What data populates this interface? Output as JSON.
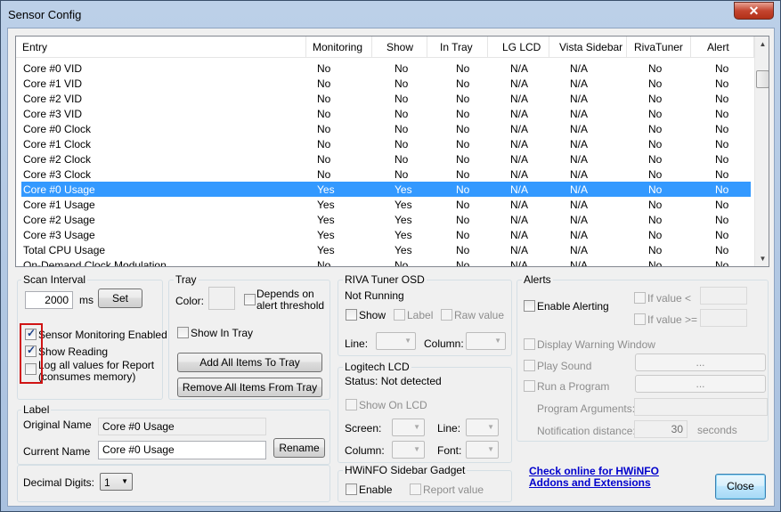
{
  "window": {
    "title": "Sensor Config",
    "close_glyph": "✕"
  },
  "list": {
    "columns": [
      "Entry",
      "Monitoring",
      "Show",
      "In Tray",
      "LG LCD",
      "Vista Sidebar",
      "RivaTuner",
      "Alert"
    ],
    "rows": [
      [
        "Core #0 VID",
        "No",
        "No",
        "No",
        "N/A",
        "N/A",
        "No",
        "No"
      ],
      [
        "Core #1 VID",
        "No",
        "No",
        "No",
        "N/A",
        "N/A",
        "No",
        "No"
      ],
      [
        "Core #2 VID",
        "No",
        "No",
        "No",
        "N/A",
        "N/A",
        "No",
        "No"
      ],
      [
        "Core #3 VID",
        "No",
        "No",
        "No",
        "N/A",
        "N/A",
        "No",
        "No"
      ],
      [
        "Core #0 Clock",
        "No",
        "No",
        "No",
        "N/A",
        "N/A",
        "No",
        "No"
      ],
      [
        "Core #1 Clock",
        "No",
        "No",
        "No",
        "N/A",
        "N/A",
        "No",
        "No"
      ],
      [
        "Core #2 Clock",
        "No",
        "No",
        "No",
        "N/A",
        "N/A",
        "No",
        "No"
      ],
      [
        "Core #3 Clock",
        "No",
        "No",
        "No",
        "N/A",
        "N/A",
        "No",
        "No"
      ],
      [
        "Core #0 Usage",
        "Yes",
        "Yes",
        "No",
        "N/A",
        "N/A",
        "No",
        "No"
      ],
      [
        "Core #1 Usage",
        "Yes",
        "Yes",
        "No",
        "N/A",
        "N/A",
        "No",
        "No"
      ],
      [
        "Core #2 Usage",
        "Yes",
        "Yes",
        "No",
        "N/A",
        "N/A",
        "No",
        "No"
      ],
      [
        "Core #3 Usage",
        "Yes",
        "Yes",
        "No",
        "N/A",
        "N/A",
        "No",
        "No"
      ],
      [
        "Total CPU Usage",
        "Yes",
        "Yes",
        "No",
        "N/A",
        "N/A",
        "No",
        "No"
      ],
      [
        "On-Demand Clock Modulation",
        "No",
        "No",
        "No",
        "N/A",
        "N/A",
        "No",
        "No"
      ]
    ],
    "selected_row": 8,
    "scroll_up": "▲",
    "scroll_down": "▼"
  },
  "scan": {
    "title": "Scan Interval",
    "value": "2000",
    "unit": "ms",
    "set_label": "Set",
    "monitoring_enabled_label": "Sensor Monitoring Enabled",
    "monitoring_enabled_checked": true,
    "show_reading_label": "Show Reading",
    "show_reading_checked": true,
    "log_label_1": "Log all values for Report",
    "log_label_2": "(consumes memory)",
    "log_checked": false,
    "check_mark": "✓"
  },
  "tray": {
    "title": "Tray",
    "color_label": "Color:",
    "depends_label_1": "Depends on",
    "depends_label_2": "alert threshold",
    "show_in_tray_label": "Show In Tray",
    "add_all_label": "Add All Items To Tray",
    "remove_all_label": "Remove All Items From Tray"
  },
  "label_group": {
    "title": "Label",
    "original_name_label": "Original Name",
    "original_name_value": "Core #0 Usage",
    "current_name_label": "Current Name",
    "current_name_value": "Core #0 Usage",
    "rename_label": "Rename"
  },
  "decimal": {
    "label": "Decimal Digits:",
    "value": "1"
  },
  "riva": {
    "title": "RIVA Tuner OSD",
    "status": "Not Running",
    "show_label": "Show",
    "label_label": "Label",
    "raw_value_label": "Raw value",
    "line_label": "Line:",
    "column_label": "Column:"
  },
  "logitech": {
    "title": "Logitech LCD",
    "status": "Status: Not detected",
    "show_on_lcd_label": "Show On LCD",
    "screen_label": "Screen:",
    "line_label": "Line:",
    "column_label": "Column:",
    "font_label": "Font:"
  },
  "gadget": {
    "title": "HWiNFO Sidebar Gadget",
    "enable_label": "Enable",
    "report_value_label": "Report value"
  },
  "alerts": {
    "title": "Alerts",
    "enable_label": "Enable Alerting",
    "if_lt_label": "If value  <",
    "if_ge_label": "If value >=",
    "display_warning_label": "Display Warning Window",
    "play_sound_label": "Play Sound",
    "run_program_label": "Run a Program",
    "browse_label": "...",
    "program_args_label": "Program Arguments:",
    "notification_label": "Notification distance:",
    "notification_value": "30",
    "seconds_label": "seconds"
  },
  "footer": {
    "link_line1": "Check online for HWiNFO",
    "link_line2": "Addons and Extensions",
    "close_label": "Close"
  }
}
